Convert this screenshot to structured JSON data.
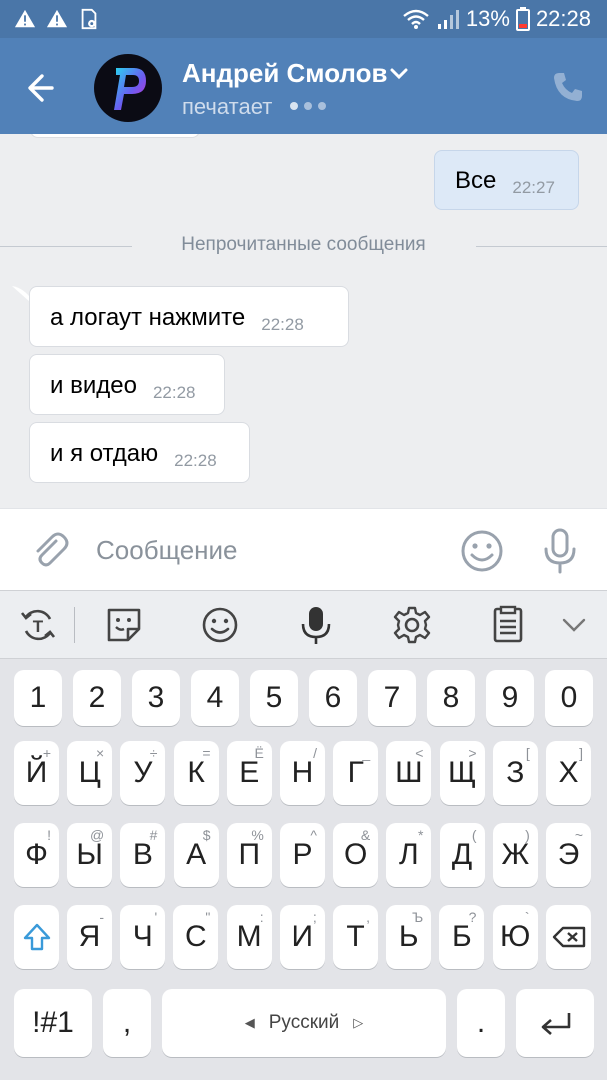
{
  "status_bar": {
    "battery_percent": "13%",
    "time": "22:28",
    "icons": [
      "warning-icon",
      "warning-icon",
      "sim-settings-icon",
      "wifi-icon",
      "signal-icon",
      "battery-icon"
    ]
  },
  "header": {
    "contact_name": "Андрей Смолов",
    "status": "печатает",
    "icons": [
      "back-arrow-icon",
      "chevron-down-icon",
      "phone-icon"
    ]
  },
  "chat": {
    "outgoing": [
      {
        "text": "Все",
        "time": "22:27"
      }
    ],
    "unread_divider": "Непрочитанные сообщения",
    "incoming": [
      {
        "text": "а логаут нажмите",
        "time": "22:28"
      },
      {
        "text": "и видео",
        "time": "22:28"
      },
      {
        "text": "и я отдаю",
        "time": "22:28"
      }
    ]
  },
  "composer": {
    "placeholder": "Сообщение",
    "icons": [
      "paperclip-icon",
      "smiley-icon",
      "microphone-icon"
    ]
  },
  "keyboard": {
    "toolbar_icons": [
      "translate-icon",
      "sticker-icon",
      "emoji-icon",
      "voice-input-icon",
      "settings-icon",
      "clipboard-icon",
      "collapse-chevron-icon"
    ],
    "numbers": [
      "1",
      "2",
      "3",
      "4",
      "5",
      "6",
      "7",
      "8",
      "9",
      "0"
    ],
    "row1": [
      {
        "k": "Й",
        "s": "+"
      },
      {
        "k": "Ц",
        "s": "×"
      },
      {
        "k": "У",
        "s": "÷"
      },
      {
        "k": "К",
        "s": "="
      },
      {
        "k": "Е",
        "s": "Ё"
      },
      {
        "k": "Н",
        "s": "/"
      },
      {
        "k": "Г",
        "s": "_"
      },
      {
        "k": "Ш",
        "s": "<"
      },
      {
        "k": "Щ",
        "s": ">"
      },
      {
        "k": "З",
        "s": "["
      },
      {
        "k": "Х",
        "s": "]"
      }
    ],
    "row2": [
      {
        "k": "Ф",
        "s": "!"
      },
      {
        "k": "Ы",
        "s": "@"
      },
      {
        "k": "В",
        "s": "#"
      },
      {
        "k": "А",
        "s": "$"
      },
      {
        "k": "П",
        "s": "%"
      },
      {
        "k": "Р",
        "s": "^"
      },
      {
        "k": "О",
        "s": "&"
      },
      {
        "k": "Л",
        "s": "*"
      },
      {
        "k": "Д",
        "s": "("
      },
      {
        "k": "Ж",
        "s": ")"
      },
      {
        "k": "Э",
        "s": "~"
      }
    ],
    "row3": [
      {
        "k": "Я",
        "s": "-"
      },
      {
        "k": "Ч",
        "s": "'"
      },
      {
        "k": "С",
        "s": "\""
      },
      {
        "k": "М",
        "s": ":"
      },
      {
        "k": "И",
        "s": ";"
      },
      {
        "k": "Т",
        "s": ","
      },
      {
        "k": "Ь",
        "s": "Ъ"
      },
      {
        "k": "Б",
        "s": "?"
      },
      {
        "k": "Ю",
        "s": "`"
      }
    ],
    "symbols_key": "!#1",
    "comma_key": ",",
    "space_label": "Русский",
    "period_key": "."
  }
}
